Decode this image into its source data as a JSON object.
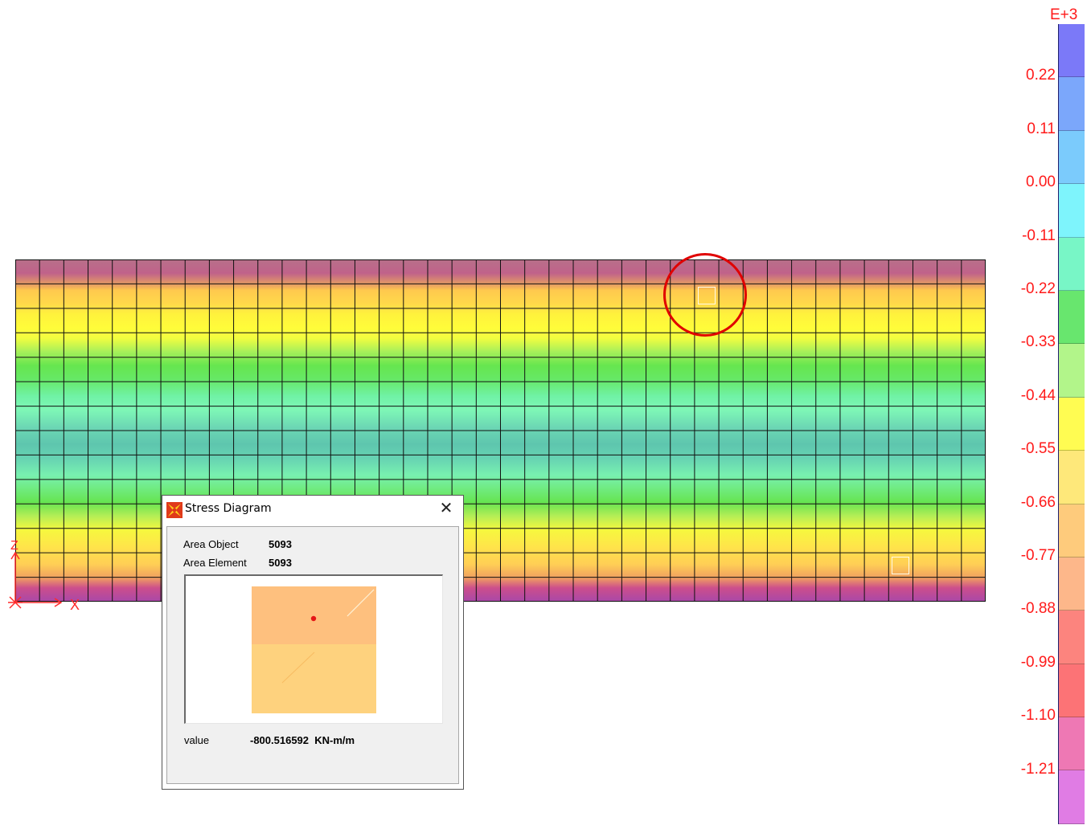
{
  "legend": {
    "exponent": "E+3",
    "labels": [
      "0.22",
      "0.11",
      "0.00",
      "-0.11",
      "-0.22",
      "-0.33",
      "-0.44",
      "-0.55",
      "-0.66",
      "-0.77",
      "-0.88",
      "-0.99",
      "-1.10",
      "-1.21"
    ],
    "colors": [
      "#7b79f8",
      "#7ba7fb",
      "#7bcbfc",
      "#7ef4fc",
      "#78f6c6",
      "#68e66e",
      "#b2f58a",
      "#fffc52",
      "#fee87a",
      "#fecb7c",
      "#fdb78a",
      "#fc847e",
      "#fc7376",
      "#ee78b4",
      "#e07ce4"
    ]
  },
  "axes": {
    "x_label": "X",
    "z_label": "Z"
  },
  "dialog": {
    "title": "Stress Diagram",
    "close_glyph": "✕",
    "area_object_label": "Area Object",
    "area_object_value": "5093",
    "area_element_label": "Area Element",
    "area_element_value": "5093",
    "value_label": "value",
    "value_text": "-800.516592  KN-m/m"
  },
  "colors": {
    "highlight": "#e00000",
    "legend_text": "#ff1a1a",
    "axis": "#ff2a2a"
  }
}
